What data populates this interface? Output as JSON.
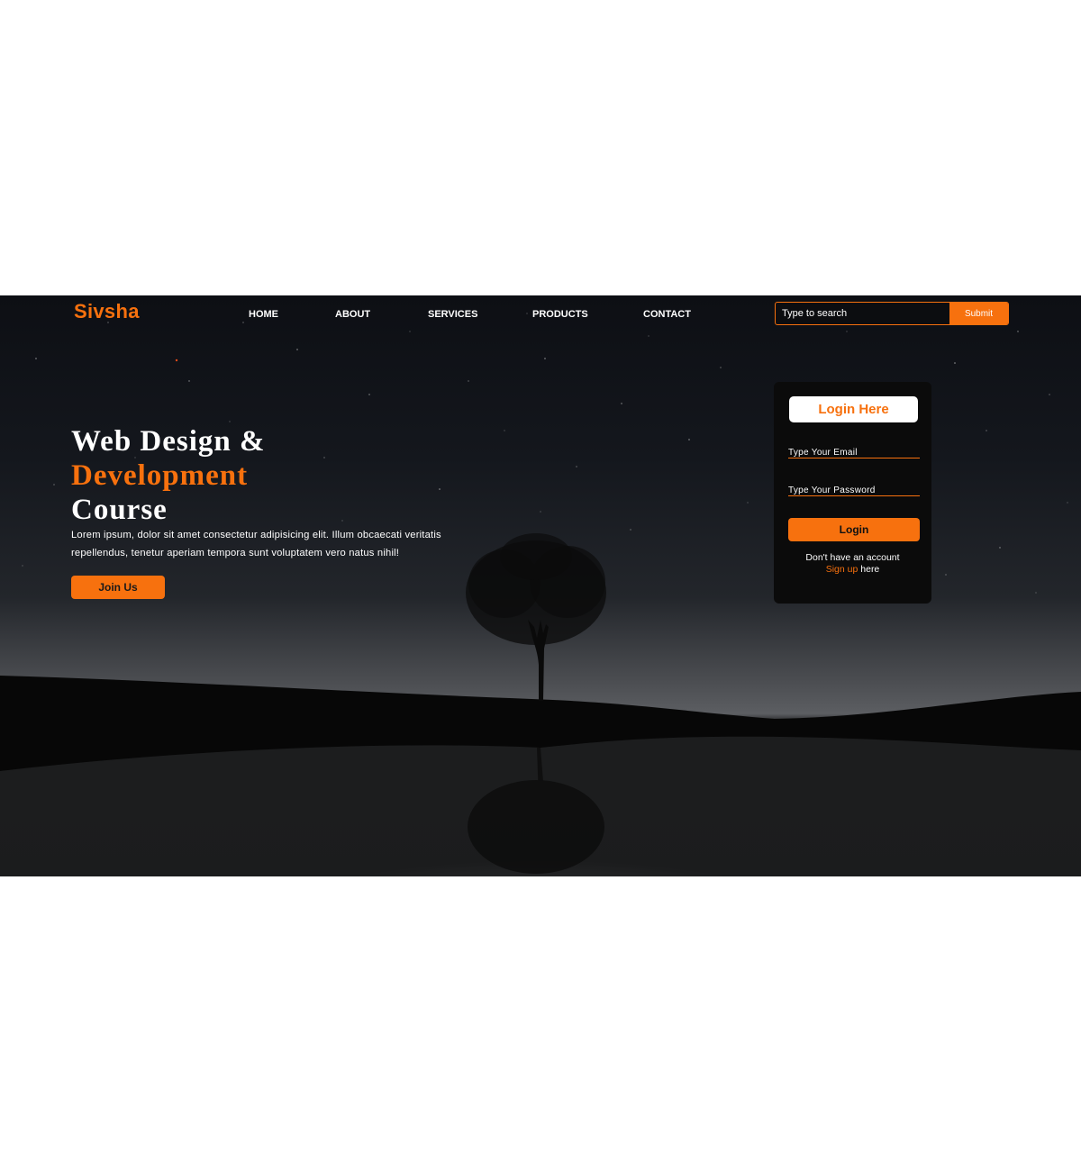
{
  "brand": {
    "name": "Sivsha"
  },
  "nav": {
    "items": [
      {
        "label": "HOME"
      },
      {
        "label": "ABOUT"
      },
      {
        "label": "SERVICES"
      },
      {
        "label": "PRODUCTS"
      },
      {
        "label": "CONTACT"
      }
    ]
  },
  "search": {
    "placeholder": "Type to search",
    "button_label": "Submit"
  },
  "hero": {
    "title_line1": "Web Design &",
    "title_line2": "Development",
    "title_line3": "Course",
    "description": "Lorem ipsum, dolor sit amet consectetur adipisicing elit. Illum obcaecati veritatis repellendus, tenetur aperiam tempora sunt voluptatem vero natus nihil!",
    "cta_label": "Join Us"
  },
  "login": {
    "title": "Login Here",
    "email_placeholder": "Type Your Email",
    "password_placeholder": "Type Your Password",
    "button_label": "Login",
    "signup_prompt": "Don't have an account",
    "signup_link": "Sign up",
    "signup_suffix": " here"
  },
  "colors": {
    "accent": "#f7710e",
    "card_bg": "#0b0b0b",
    "text": "#ffffff"
  }
}
